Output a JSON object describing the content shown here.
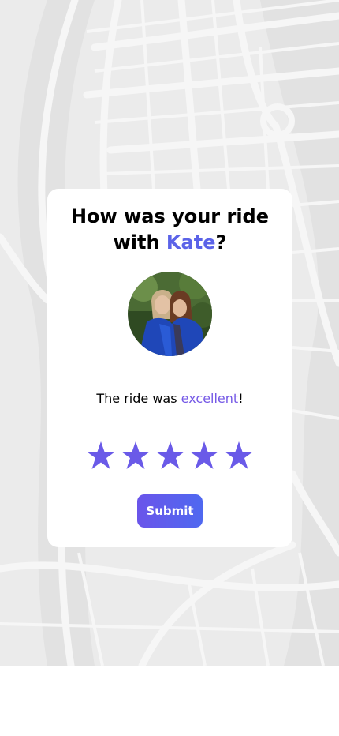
{
  "rating_card": {
    "title_line1": "How was your ride",
    "title_with": "with ",
    "driver_name": "Kate",
    "title_end": "?",
    "rating_prefix": "The ride was ",
    "rating_word": "excellent",
    "rating_suffix": "!",
    "stars_total": 5,
    "stars_selected": 5,
    "submit_label": "Submit"
  },
  "colors": {
    "accent": "#5b63e8",
    "star": "#6a5ae8",
    "map_background": "#ebebeb"
  }
}
